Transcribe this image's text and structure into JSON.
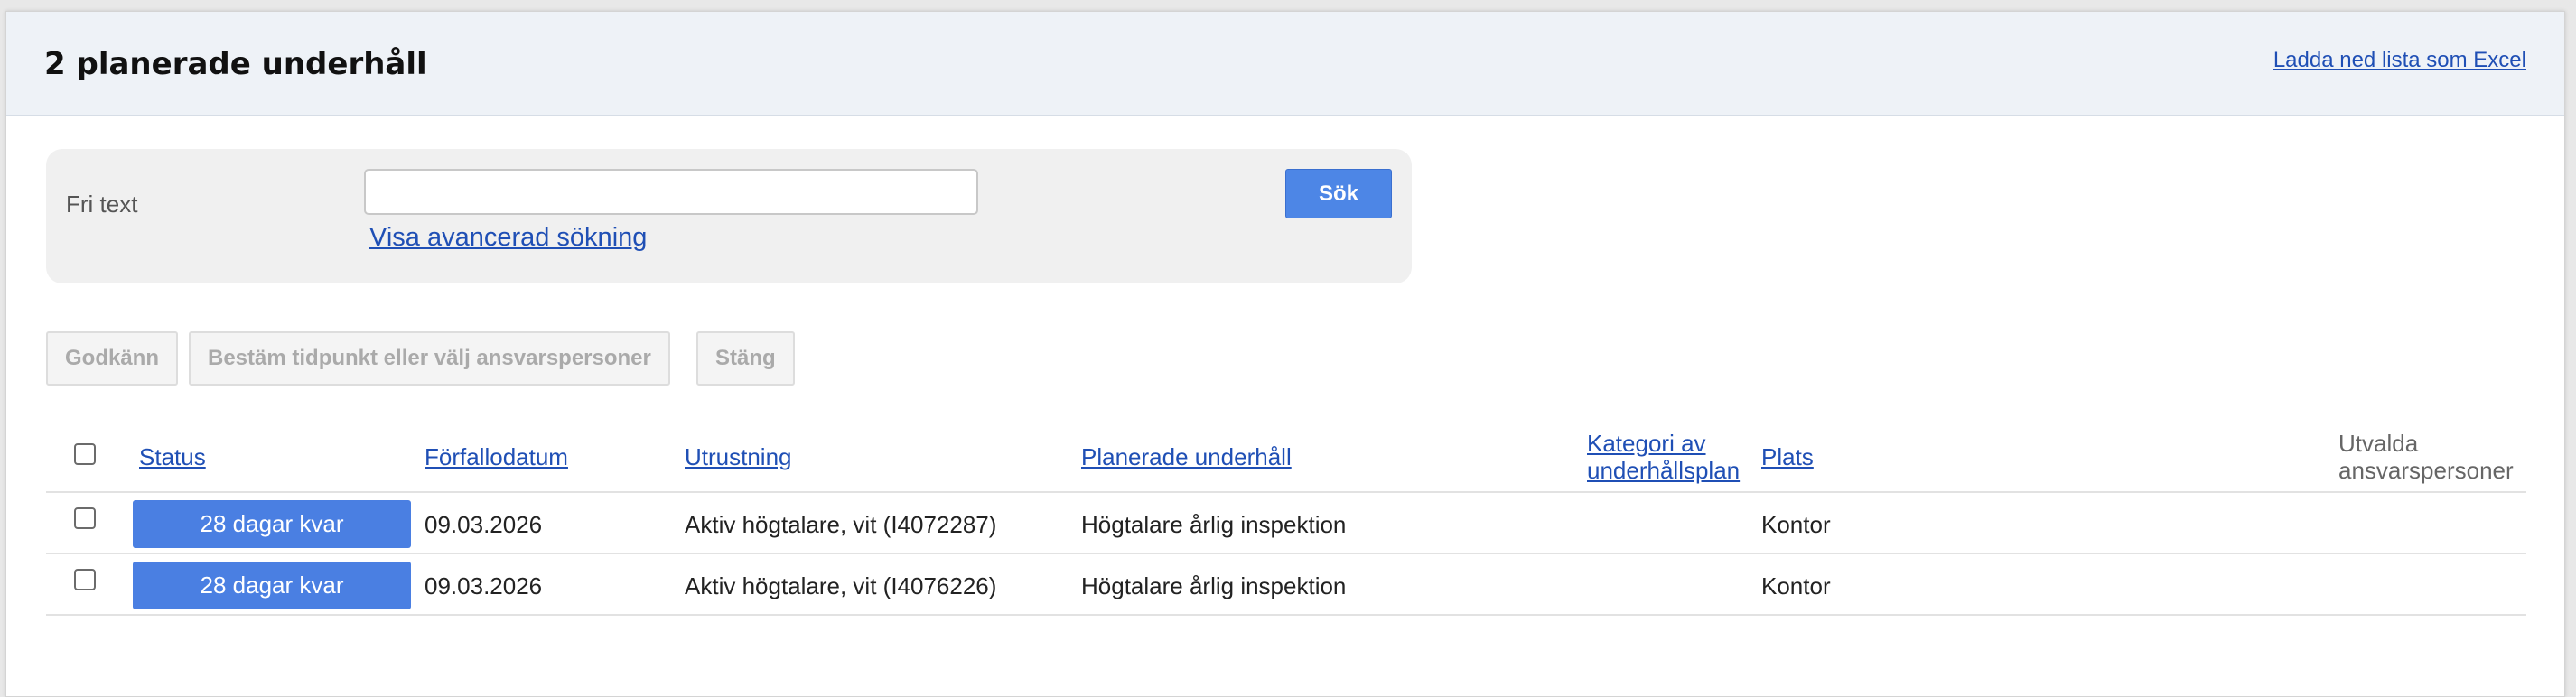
{
  "header": {
    "title": "2 planerade underhåll",
    "excel_link": "Ladda ned lista som Excel"
  },
  "search": {
    "label": "Fri text",
    "value": "",
    "placeholder": "",
    "advanced_link": "Visa avancerad sökning",
    "button": "Sök"
  },
  "actions": {
    "approve": "Godkänn",
    "schedule": "Bestäm tidpunkt eller välj ansvarspersoner",
    "close": "Stäng"
  },
  "columns": {
    "status": "Status",
    "due_date": "Förfallodatum",
    "equipment": "Utrustning",
    "planned": "Planerade underhåll",
    "category_line1": "Kategori av",
    "category_line2": "underhållsplan",
    "place": "Plats",
    "responsible_line1": "Utvalda",
    "responsible_line2": "ansvarspersoner"
  },
  "rows": [
    {
      "status": "28 dagar kvar",
      "due_date": "09.03.2026",
      "equipment": "Aktiv högtalare, vit (I4072287)",
      "planned": "Högtalare årlig inspektion",
      "category": "",
      "place": "Kontor",
      "responsible": ""
    },
    {
      "status": "28 dagar kvar",
      "due_date": "09.03.2026",
      "equipment": "Aktiv högtalare, vit (I4076226)",
      "planned": "Högtalare årlig inspektion",
      "category": "",
      "place": "Kontor",
      "responsible": ""
    }
  ],
  "colors": {
    "accent": "#4a7fe2",
    "link": "#1f4fb5",
    "header_bg": "#eef2f7"
  }
}
